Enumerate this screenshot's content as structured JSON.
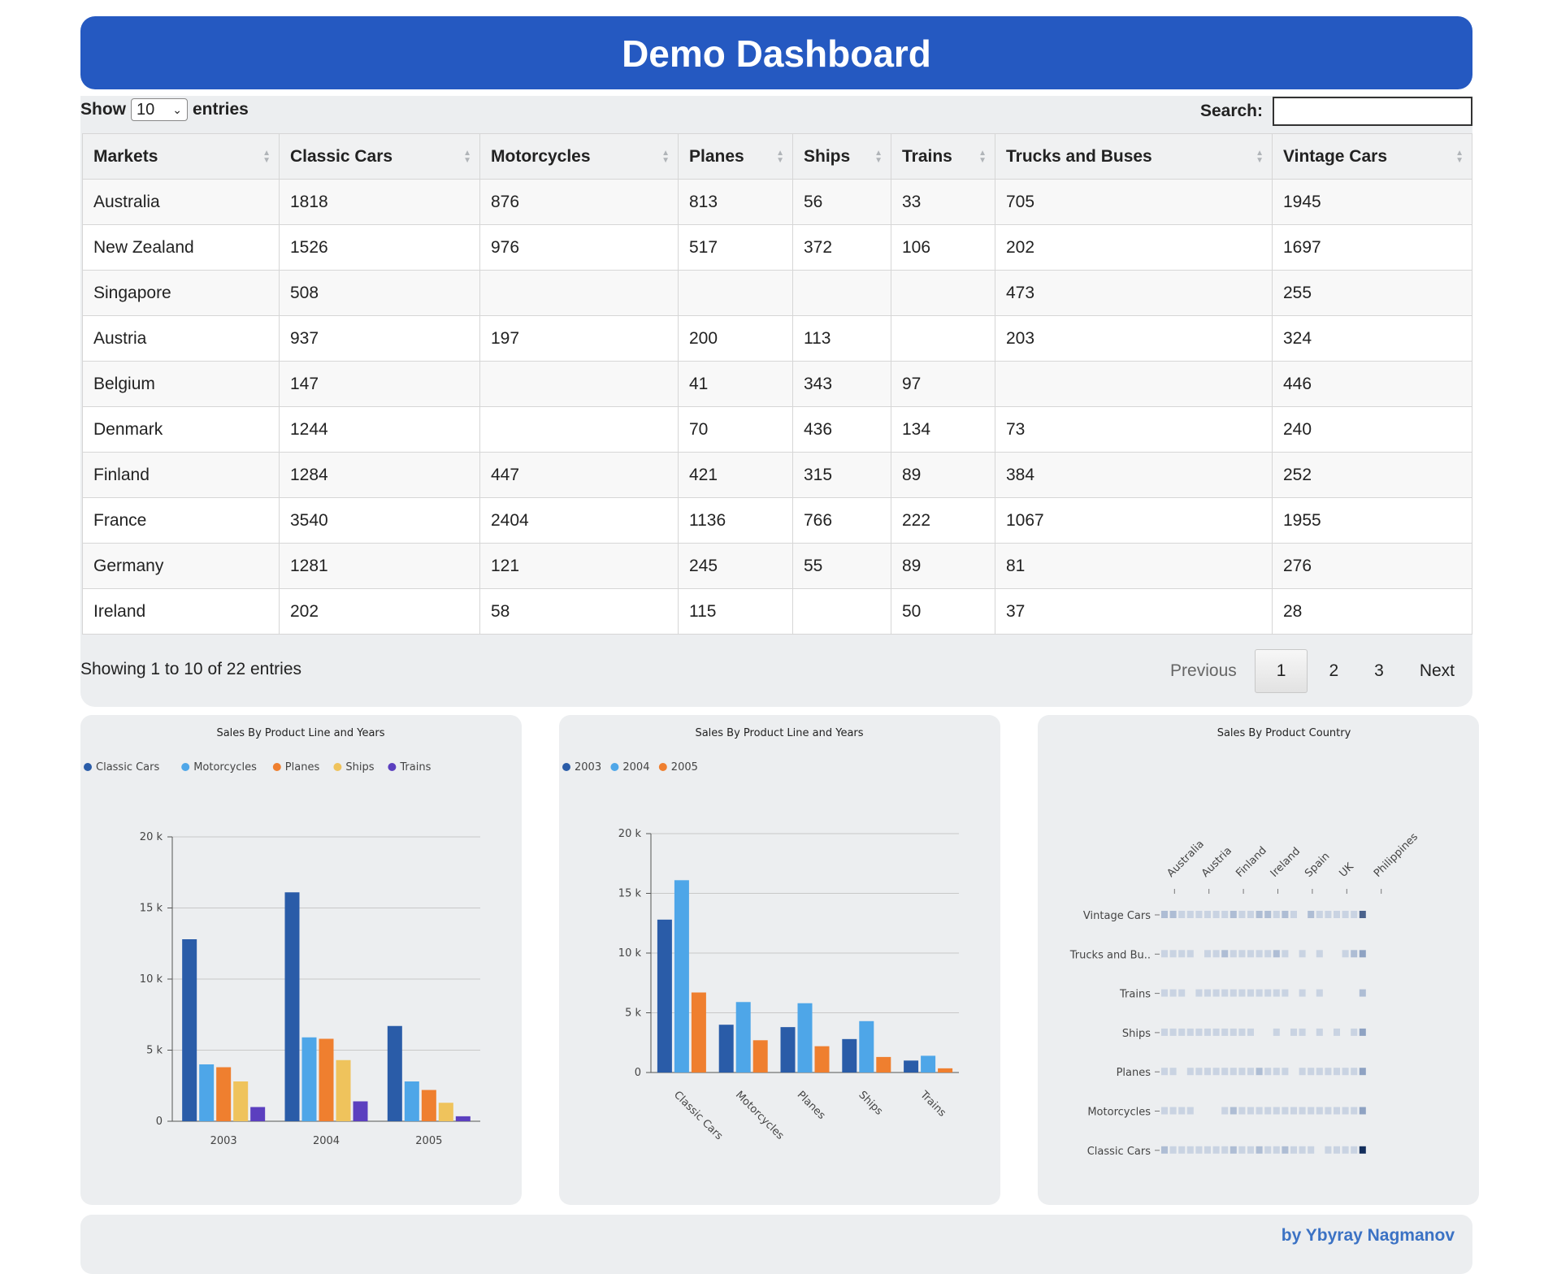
{
  "header": {
    "title": "Demo Dashboard"
  },
  "table_controls": {
    "show_label": "Show",
    "entries_label": "entries",
    "page_length": "10",
    "search_label": "Search:",
    "search_value": ""
  },
  "table": {
    "columns": [
      "Markets",
      "Classic Cars",
      "Motorcycles",
      "Planes",
      "Ships",
      "Trains",
      "Trucks and Buses",
      "Vintage Cars"
    ],
    "rows": [
      [
        "Australia",
        "1818",
        "876",
        "813",
        "56",
        "33",
        "705",
        "1945"
      ],
      [
        "New Zealand",
        "1526",
        "976",
        "517",
        "372",
        "106",
        "202",
        "1697"
      ],
      [
        "Singapore",
        "508",
        "",
        "",
        "",
        "",
        "473",
        "255"
      ],
      [
        "Austria",
        "937",
        "197",
        "200",
        "113",
        "",
        "203",
        "324"
      ],
      [
        "Belgium",
        "147",
        "",
        "41",
        "343",
        "97",
        "",
        "446"
      ],
      [
        "Denmark",
        "1244",
        "",
        "70",
        "436",
        "134",
        "73",
        "240"
      ],
      [
        "Finland",
        "1284",
        "447",
        "421",
        "315",
        "89",
        "384",
        "252"
      ],
      [
        "France",
        "3540",
        "2404",
        "1136",
        "766",
        "222",
        "1067",
        "1955"
      ],
      [
        "Germany",
        "1281",
        "121",
        "245",
        "55",
        "89",
        "81",
        "276"
      ],
      [
        "Ireland",
        "202",
        "58",
        "115",
        "",
        "50",
        "37",
        "28"
      ]
    ]
  },
  "table_info": "Showing 1 to 10 of 22 entries",
  "pagination": {
    "previous": "Previous",
    "pages": [
      "1",
      "2",
      "3"
    ],
    "current": "1",
    "next": "Next"
  },
  "colors": {
    "header_bg": "#2559c1",
    "panel_bg": "#eceef0",
    "series": [
      "#2a5ca8",
      "#4ea6e8",
      "#ef7f2f",
      "#efc35c",
      "#5b3fbf"
    ],
    "footer_text": "#3b72c4"
  },
  "chart_data": [
    {
      "type": "bar",
      "title": "Sales By Product Line and Years",
      "categories": [
        "2003",
        "2004",
        "2005"
      ],
      "series": [
        {
          "name": "Classic Cars",
          "values": [
            12800,
            16100,
            6700
          ]
        },
        {
          "name": "Motorcycles",
          "values": [
            4000,
            5900,
            2800
          ]
        },
        {
          "name": "Planes",
          "values": [
            3800,
            5800,
            2200
          ]
        },
        {
          "name": "Ships",
          "values": [
            2800,
            4300,
            1300
          ]
        },
        {
          "name": "Trains",
          "values": [
            1000,
            1400,
            350
          ]
        }
      ],
      "ylim": [
        0,
        20000
      ],
      "yticks": [
        "0",
        "5 k",
        "10 k",
        "15 k",
        "20 k"
      ],
      "legend": "top-left",
      "grid": true
    },
    {
      "type": "bar",
      "title": "Sales By Product Line and Years",
      "categories": [
        "Classic Cars",
        "Motorcycles",
        "Planes",
        "Ships",
        "Trains"
      ],
      "series": [
        {
          "name": "2003",
          "values": [
            12800,
            4000,
            3800,
            2800,
            1000
          ]
        },
        {
          "name": "2004",
          "values": [
            16100,
            5900,
            5800,
            4300,
            1400
          ]
        },
        {
          "name": "2005",
          "values": [
            6700,
            2700,
            2200,
            1300,
            350
          ]
        }
      ],
      "ylim": [
        0,
        20000
      ],
      "yticks": [
        "0",
        "5 k",
        "10 k",
        "15 k",
        "20 k"
      ],
      "legend": "top-left",
      "grid": true
    },
    {
      "type": "heatmap",
      "title": "Sales By Product Country",
      "x_labels": [
        "Australia",
        "Austria",
        "Finland",
        "Ireland",
        "Spain",
        "UK",
        "Philippines"
      ],
      "y_labels": [
        "Vintage Cars",
        "Trucks and Bu..",
        "Trains",
        "Ships",
        "Planes",
        "Motorcycles",
        "Classic Cars"
      ],
      "intensity": [
        [
          2,
          2,
          1,
          1,
          1,
          1,
          1,
          1,
          2,
          1,
          1,
          2,
          2,
          1,
          2,
          1,
          0,
          2,
          1,
          1,
          1,
          1,
          1,
          4
        ],
        [
          1,
          1,
          1,
          1,
          0,
          1,
          1,
          2,
          1,
          1,
          1,
          1,
          1,
          2,
          1,
          0,
          1,
          0,
          1,
          0,
          0,
          1,
          2,
          3
        ],
        [
          1,
          1,
          1,
          0,
          1,
          1,
          1,
          1,
          1,
          1,
          1,
          1,
          1,
          1,
          1,
          0,
          1,
          0,
          1,
          0,
          0,
          0,
          0,
          2
        ],
        [
          1,
          1,
          1,
          1,
          1,
          1,
          1,
          1,
          1,
          1,
          1,
          0,
          0,
          1,
          0,
          1,
          1,
          0,
          1,
          0,
          1,
          0,
          1,
          3
        ],
        [
          1,
          1,
          0,
          1,
          1,
          1,
          1,
          1,
          1,
          1,
          1,
          2,
          1,
          1,
          1,
          0,
          1,
          1,
          1,
          1,
          1,
          1,
          1,
          3
        ],
        [
          1,
          1,
          1,
          1,
          0,
          0,
          0,
          1,
          2,
          1,
          1,
          1,
          1,
          1,
          1,
          1,
          1,
          1,
          1,
          1,
          1,
          1,
          1,
          3
        ],
        [
          2,
          1,
          1,
          1,
          1,
          1,
          1,
          1,
          2,
          1,
          1,
          2,
          1,
          1,
          2,
          1,
          1,
          1,
          0,
          1,
          1,
          1,
          1,
          5
        ]
      ]
    }
  ],
  "footer": {
    "credit": "by Ybyray Nagmanov"
  }
}
